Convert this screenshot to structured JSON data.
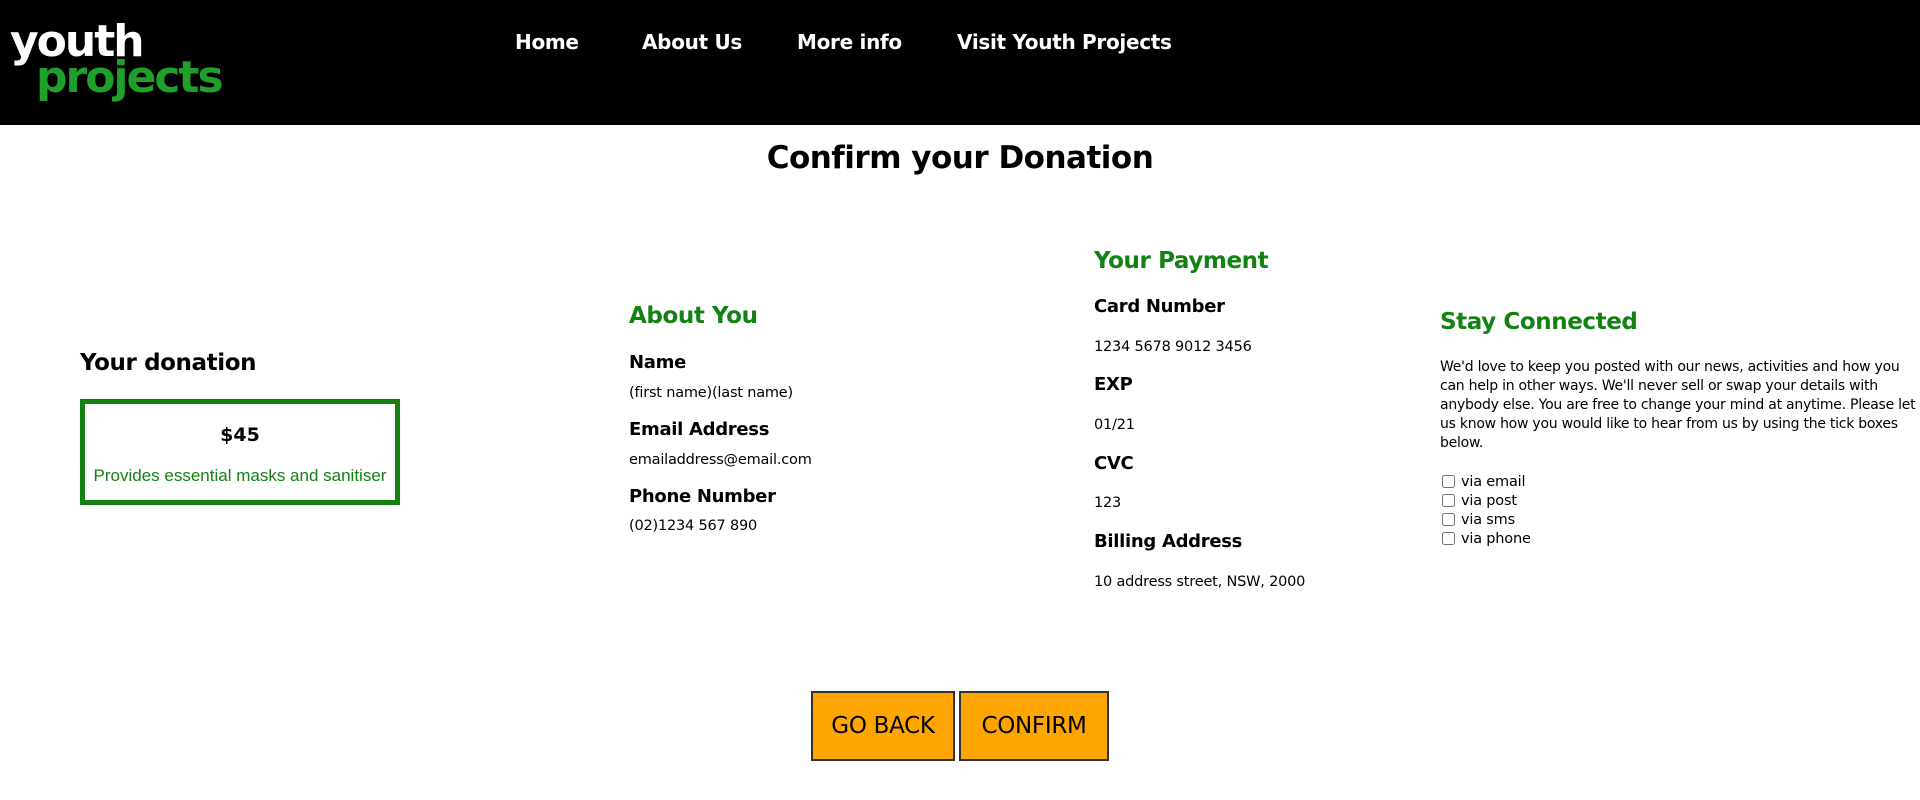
{
  "header": {
    "logo": {
      "line1": "youth",
      "line2": "projects"
    },
    "nav": [
      {
        "label": "Home"
      },
      {
        "label": "About Us"
      },
      {
        "label": "More info"
      },
      {
        "label": "Visit Youth Projects"
      }
    ]
  },
  "page": {
    "title": "Confirm your Donation"
  },
  "donation": {
    "heading": "Your donation",
    "amount": "$45",
    "description": "Provides essential masks and sanitiser"
  },
  "about_you": {
    "heading": "About You",
    "fields": [
      {
        "label": "Name",
        "value": "(first name)(last name)"
      },
      {
        "label": "Email Address",
        "value": "emailaddress@email.com"
      },
      {
        "label": "Phone Number",
        "value": "(02)1234 567 890"
      }
    ]
  },
  "payment": {
    "heading": "Your Payment",
    "fields": [
      {
        "label": "Card Number",
        "value": "1234 5678 9012 3456"
      },
      {
        "label": "EXP",
        "value": "01/21"
      },
      {
        "label": "CVC",
        "value": "123"
      },
      {
        "label": "Billing Address",
        "value": "10 address street, NSW, 2000"
      }
    ]
  },
  "stay_connected": {
    "heading": "Stay Connected",
    "text": "We'd love to keep you posted with our news, activities and how you can help in other ways. We'll never sell or swap your details with anybody else. You are free to change your mind at anytime. Please let us know how you would like to hear from us by using the tick boxes below.",
    "options": [
      {
        "label": "via email",
        "checked": false
      },
      {
        "label": "via post",
        "checked": false
      },
      {
        "label": "via sms",
        "checked": false
      },
      {
        "label": "via phone",
        "checked": false
      }
    ]
  },
  "actions": {
    "back_label": "GO BACK",
    "confirm_label": "CONFIRM"
  },
  "colors": {
    "header_bg": "#000000",
    "accent_green": "#138213",
    "button_bg": "#ffa500"
  }
}
